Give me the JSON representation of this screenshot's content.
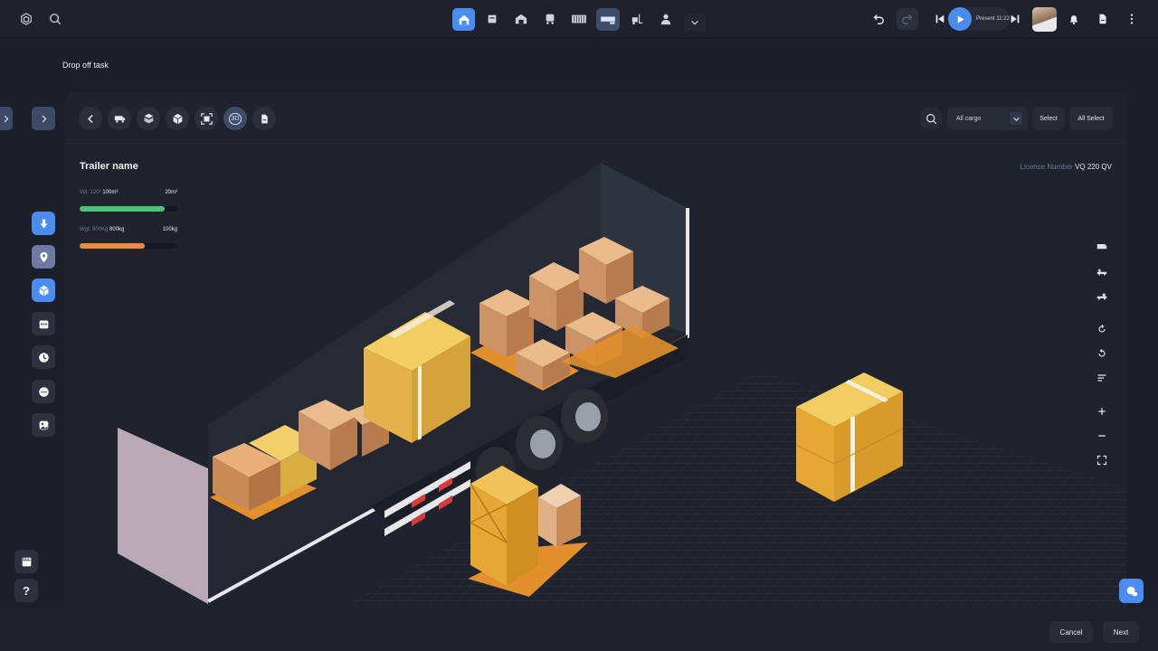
{
  "topbar": {
    "nav_icons": [
      "home-icon",
      "document-icon",
      "warehouse-icon",
      "truck-icon",
      "container-icon",
      "trailer-icon",
      "forklift-icon",
      "user-icon",
      "chevron-down-icon"
    ],
    "present_label": "Present 11:22"
  },
  "breadcrumb": "Drop off task",
  "toolbar": {
    "view_3d_label": "3D",
    "cargo_filter": "All cargo",
    "select_label": "Select",
    "all_select_label": "All Select"
  },
  "trailer": {
    "name": "Trailer name",
    "license_label": "License Number",
    "license_value": "VQ 220 QV",
    "volume": {
      "label": "Vol: 120³",
      "used": "100m³",
      "remaining": "20m³",
      "fill_fraction": 0.87
    },
    "weight": {
      "label": "Wgt: 900Kg",
      "used": "800kg",
      "remaining": "100kg",
      "fill_fraction": 0.67
    }
  },
  "colors": {
    "accent": "#4a8cf0",
    "volume_bar": "#4ec07a",
    "weight_bar": "#ef8a3c"
  },
  "footer": {
    "cancel_label": "Cancel",
    "next_label": "Next"
  }
}
